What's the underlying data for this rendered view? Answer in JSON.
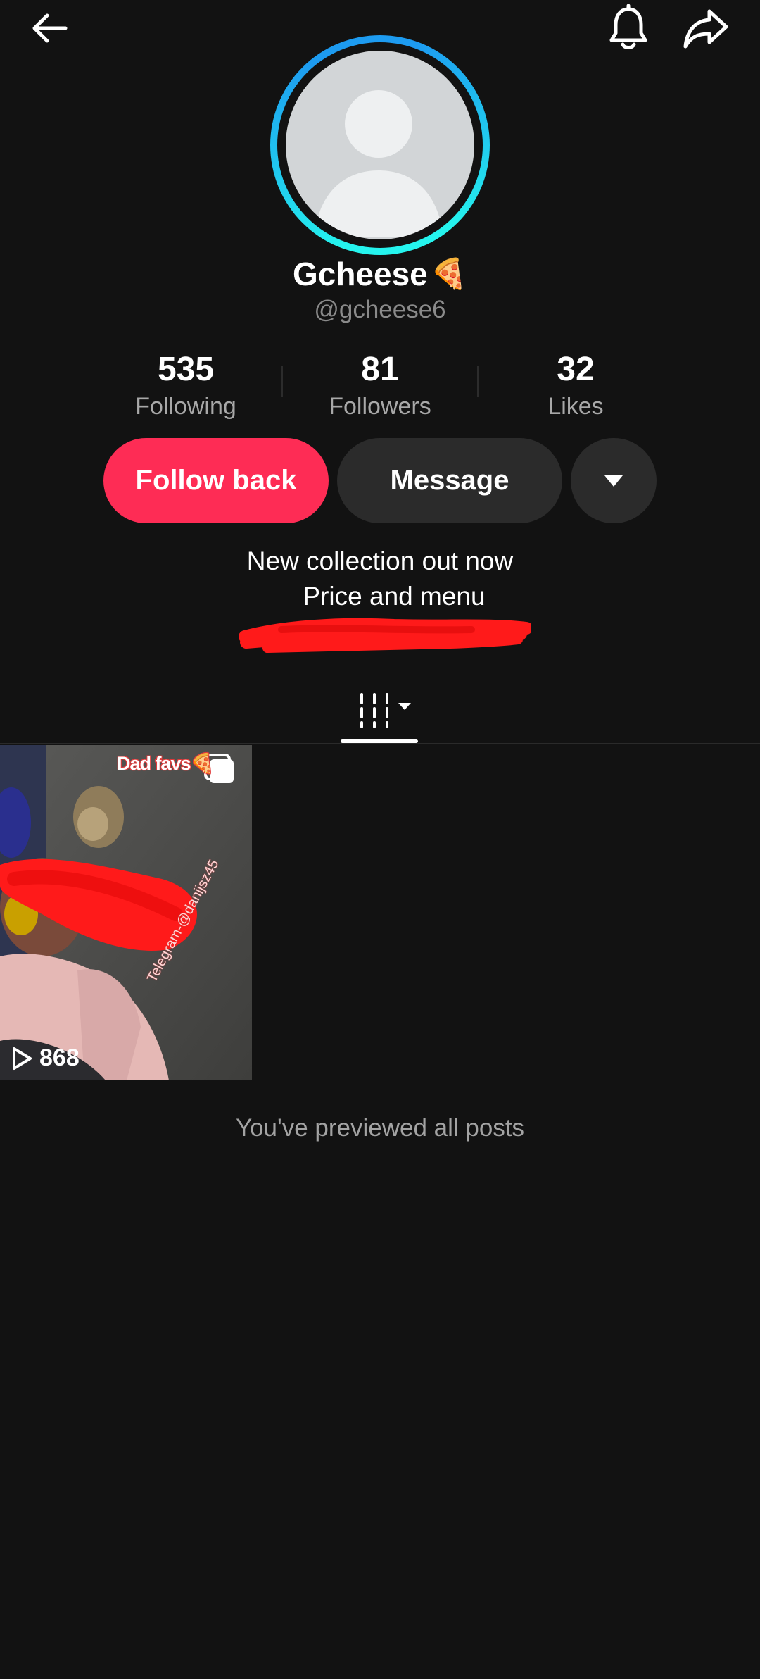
{
  "profile": {
    "display_name": "Gcheese",
    "name_emoji": "🍕",
    "handle": "@gcheese6"
  },
  "stats": [
    {
      "value": "535",
      "label": "Following"
    },
    {
      "value": "81",
      "label": "Followers"
    },
    {
      "value": "32",
      "label": "Likes"
    }
  ],
  "actions": {
    "follow_label": "Follow back",
    "message_label": "Message"
  },
  "bio": {
    "line1": "New collection out now",
    "line2": "Price and menu"
  },
  "posts": [
    {
      "overlay_text": "Dad favs",
      "overlay_emoji": "🍕",
      "views": "868",
      "watermark": "Telegram-@danijsz45"
    }
  ],
  "end_note": "You've previewed all posts",
  "colors": {
    "background": "#121212",
    "follow_button": "#fe2c55",
    "secondary_button": "#2b2b2b",
    "avatar_ring_start": "#25f4ee",
    "avatar_ring_end": "#1d9bf0",
    "redaction": "#ff1a1a"
  },
  "icons": {
    "back": "arrow-left-icon",
    "notifications": "bell-icon",
    "share": "share-arrow-icon",
    "more": "caret-down-icon",
    "grid_tab": "grid-columns-icon",
    "views": "play-icon",
    "multi_image": "carousel-icon"
  }
}
